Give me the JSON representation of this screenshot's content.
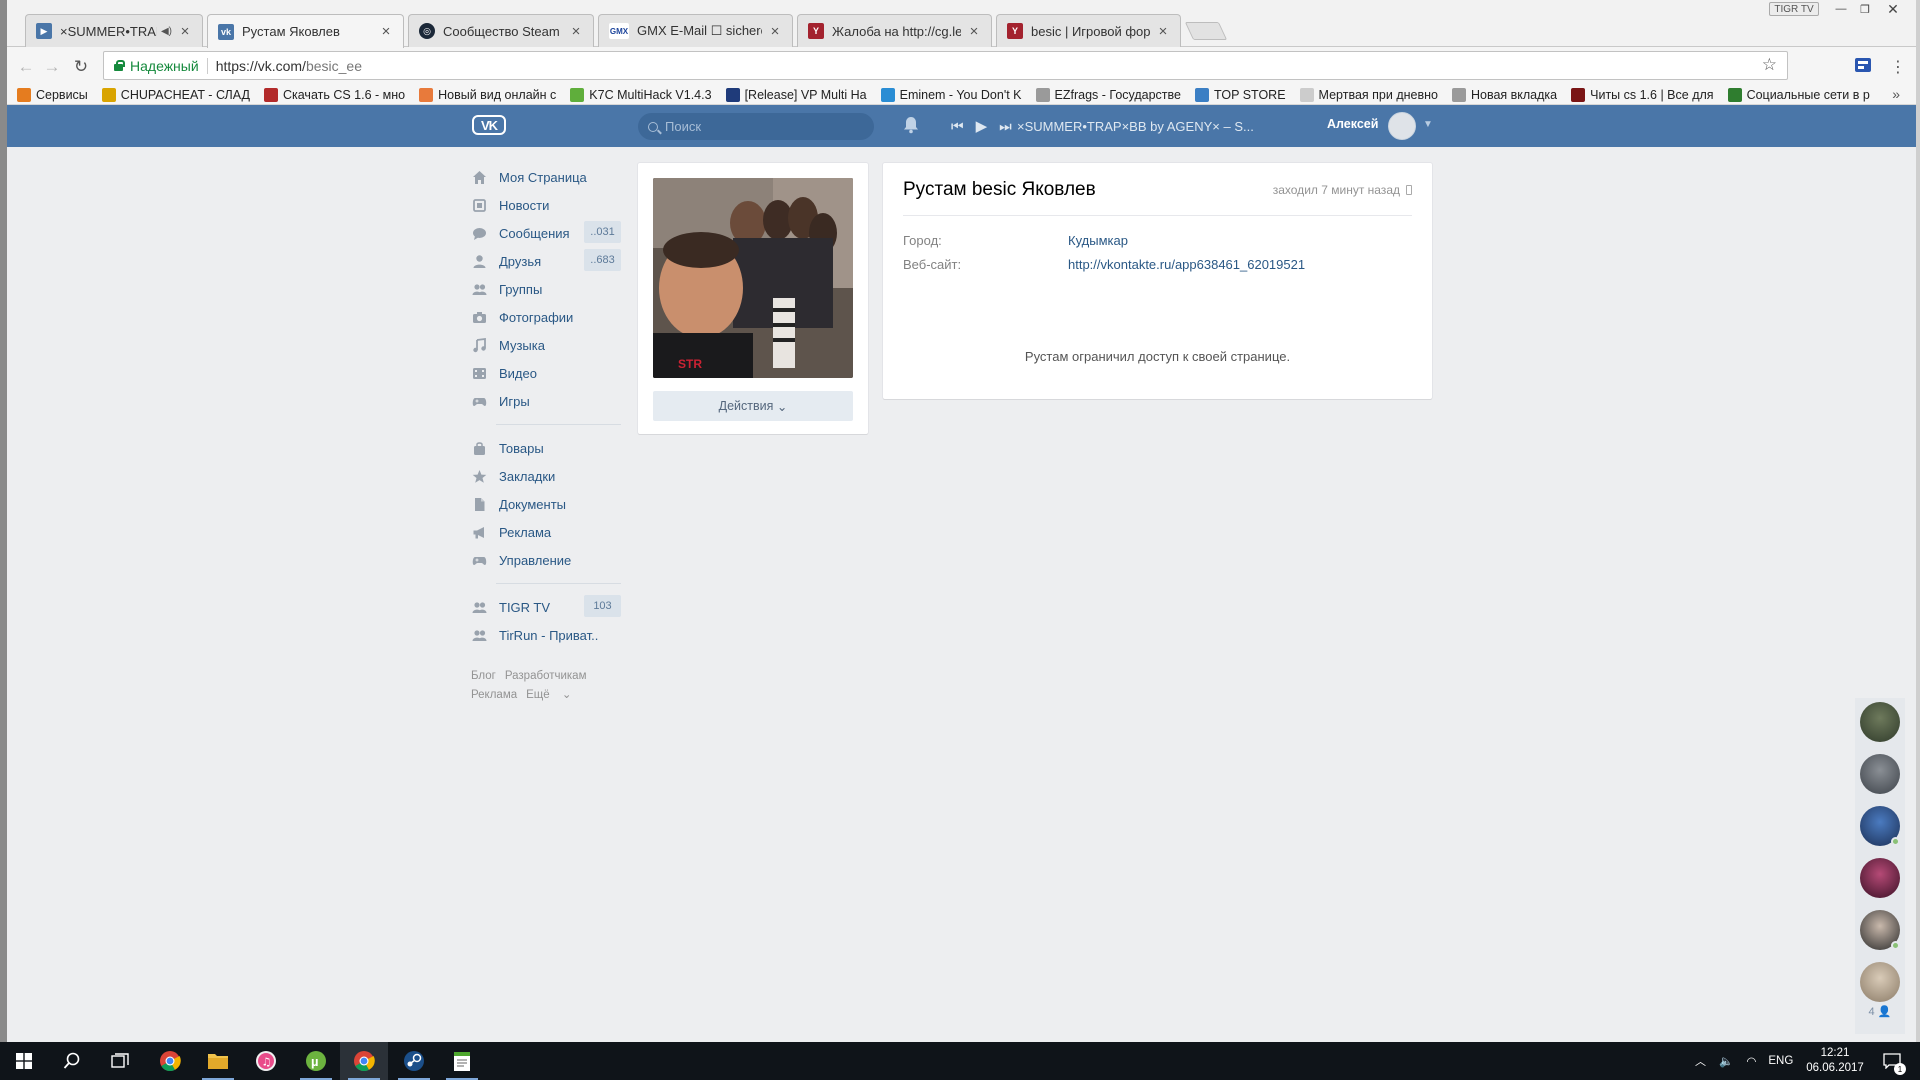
{
  "browser": {
    "tabs": [
      {
        "title": "×SUMMER•TRAP×BB",
        "favicon": "play-icon",
        "color": "#4a76a8"
      },
      {
        "title": "Рустам Яковлев",
        "favicon": "vk-icon",
        "color": "#4a76a8"
      },
      {
        "title": "Сообщество Steam :: De",
        "favicon": "steam-icon",
        "color": "#1b2838"
      },
      {
        "title": "GMX E-Mail ☐ sichere",
        "favicon": "gmx-icon",
        "color": "#1c449b"
      },
      {
        "title": "Жалоба на http://cg.lequ",
        "favicon": "y-icon",
        "color": "#a3222e"
      },
      {
        "title": "besic | Игровой форум",
        "favicon": "y-icon",
        "color": "#a3222e"
      }
    ],
    "profile_badge": "TIGR TV",
    "secure_label": "Надежный",
    "url_host": "https://vk.com/",
    "url_path": "besic_ee",
    "bookmarks": [
      {
        "label": "Сервисы",
        "icon": "apps-icon",
        "color": "#e57c1f"
      },
      {
        "label": "CHUPACHEAT - СЛАД",
        "icon": "chupa-icon",
        "color": "#d9a400"
      },
      {
        "label": "Скачать CS 1.6 - мно",
        "icon": "cs-icon",
        "color": "#b22a2a"
      },
      {
        "label": "Новый вид онлайн с",
        "icon": "p-icon",
        "color": "#e87a3b"
      },
      {
        "label": "K7C MultiHack V1.4.3",
        "icon": "m-icon",
        "color": "#5fae3b"
      },
      {
        "label": "[Release] VP Multi Ha",
        "icon": "mpgh-icon",
        "color": "#1f3b7a"
      },
      {
        "label": "Eminem - You Don't K",
        "icon": "music-icon",
        "color": "#2a8dd4"
      },
      {
        "label": "EZfrags - Государстве",
        "icon": "page-icon",
        "color": "#9a9a9a"
      },
      {
        "label": "TOP STORE",
        "icon": "store-icon",
        "color": "#3b7fc4"
      },
      {
        "label": "Мертвая при дневно",
        "icon": "doc-icon",
        "color": "#cccccc"
      },
      {
        "label": "Новая вкладка",
        "icon": "page-icon",
        "color": "#9a9a9a"
      },
      {
        "label": "Читы cs 1.6 | Все для",
        "icon": "cheat-icon",
        "color": "#7a1515"
      },
      {
        "label": "Социальные сети в р",
        "icon": "social-icon",
        "color": "#2f7d2f"
      }
    ]
  },
  "vk": {
    "search_placeholder": "Поиск",
    "track": "×SUMMER•TRAP×BB by AGENY× – S...",
    "user_name": "Алексей",
    "menu": [
      {
        "label": "Моя Страница",
        "icon": "home-icon",
        "count": ""
      },
      {
        "label": "Новости",
        "icon": "news-icon",
        "count": ""
      },
      {
        "label": "Сообщения",
        "icon": "messages-icon",
        "count": "..031"
      },
      {
        "label": "Друзья",
        "icon": "friends-icon",
        "count": "..683"
      },
      {
        "label": "Группы",
        "icon": "groups-icon",
        "count": ""
      },
      {
        "label": "Фотографии",
        "icon": "camera-icon",
        "count": ""
      },
      {
        "label": "Музыка",
        "icon": "music-note-icon",
        "count": ""
      },
      {
        "label": "Видео",
        "icon": "video-icon",
        "count": ""
      },
      {
        "label": "Игры",
        "icon": "gamepad-icon",
        "count": ""
      }
    ],
    "menu2": [
      {
        "label": "Товары",
        "icon": "bag-icon"
      },
      {
        "label": "Закладки",
        "icon": "star-icon"
      },
      {
        "label": "Документы",
        "icon": "document-icon"
      },
      {
        "label": "Реклама",
        "icon": "megaphone-icon"
      },
      {
        "label": "Управление",
        "icon": "gamepad-icon"
      }
    ],
    "menu3": [
      {
        "label": "TIGR TV",
        "icon": "groups-icon",
        "count": "103"
      },
      {
        "label": "TirRun - Приват..",
        "icon": "groups-icon",
        "count": ""
      }
    ],
    "footer": {
      "blog": "Блог",
      "dev": "Разработчикам",
      "ads": "Реклама",
      "more": "Ещё"
    },
    "profile": {
      "name": "Рустам besic Яковлев",
      "last_seen": "заходил 7 минут назад",
      "city_label": "Город:",
      "city_value": "Кудымкар",
      "site_label": "Веб-сайт:",
      "site_value": "http://vkontakte.ru/app638461_62019521",
      "private_note": "Рустам ограничил доступ к своей странице.",
      "actions_label": "Действия"
    },
    "chat_rail": {
      "online_count": "4"
    }
  },
  "taskbar": {
    "lang": "ENG",
    "time": "12:21",
    "date": "06.06.2017",
    "notif_count": "1"
  }
}
